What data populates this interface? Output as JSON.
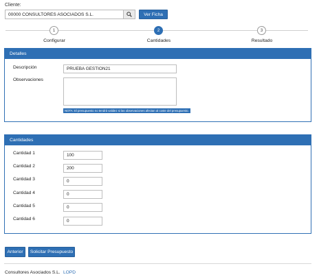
{
  "client": {
    "label": "Cliente:",
    "value": "00000 CONSULTORES ASOCIADOS S.L.",
    "ver_ficha_label": "Ver Ficha"
  },
  "wizard": {
    "current_step": 2,
    "steps": [
      {
        "number": "1",
        "label": "Configurar"
      },
      {
        "number": "2",
        "label": "Cantidades"
      },
      {
        "number": "3",
        "label": "Resultado"
      }
    ]
  },
  "detalles": {
    "title": "Detalles",
    "descripcion_label": "Descripción",
    "descripcion_value": "PRUEBA GESTION21",
    "observaciones_label": "Observaciones",
    "observaciones_value": "",
    "note": "NOTA: El presupuesto no tendrá validez si las observaciones afectan al coste del presupuesto."
  },
  "cantidades": {
    "title": "Cantidades",
    "rows": [
      {
        "label": "Cantidad 1",
        "value": "100"
      },
      {
        "label": "Cantidad 2",
        "value": "200"
      },
      {
        "label": "Cantidad 3",
        "value": "0"
      },
      {
        "label": "Cantidad 4",
        "value": "0"
      },
      {
        "label": "Cantidad 5",
        "value": "0"
      },
      {
        "label": "Cantidad 6",
        "value": "0"
      }
    ]
  },
  "actions": {
    "anterior_label": "Anterior",
    "solicitar_label": "Solicitar Presupuesto"
  },
  "footer": {
    "company": "Consultores Asociados S.L.",
    "link": "LOPD"
  },
  "colors": {
    "primary": "#2e6fb4"
  }
}
